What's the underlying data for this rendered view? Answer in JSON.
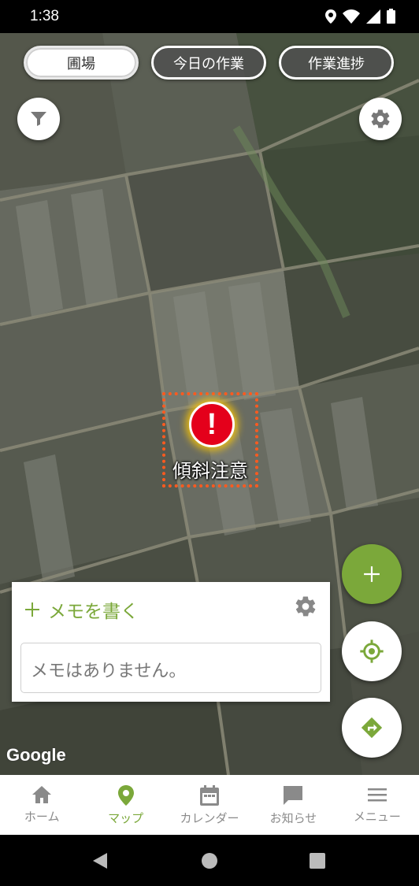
{
  "status_bar": {
    "time": "1:38"
  },
  "map": {
    "tabs": [
      {
        "label": "圃場",
        "active": true
      },
      {
        "label": "今日の作業",
        "active": false
      },
      {
        "label": "作業進捗",
        "active": false
      }
    ],
    "alert_label": "傾斜注意",
    "google_logo": "Google"
  },
  "memo": {
    "add_label": "メモを書く",
    "empty_text": "メモはありません。"
  },
  "bottom_nav": [
    {
      "label": "ホーム",
      "icon": "home-icon",
      "active": false
    },
    {
      "label": "マップ",
      "icon": "map-pin-icon",
      "active": true
    },
    {
      "label": "カレンダー",
      "icon": "calendar-icon",
      "active": false
    },
    {
      "label": "お知らせ",
      "icon": "chat-icon",
      "active": false
    },
    {
      "label": "メニュー",
      "icon": "menu-icon",
      "active": false
    }
  ],
  "colors": {
    "accent": "#7ba83a",
    "alert": "#e4001b",
    "alert_border": "#ff5a1f"
  }
}
